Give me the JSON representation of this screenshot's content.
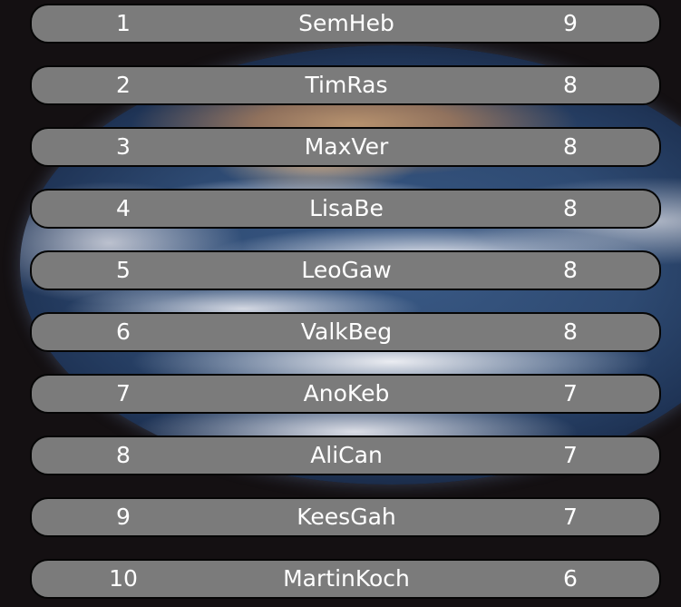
{
  "leaderboard": {
    "rows": [
      {
        "rank": "1",
        "name": "SemHeb",
        "score": "9"
      },
      {
        "rank": "2",
        "name": "TimRas",
        "score": "8"
      },
      {
        "rank": "3",
        "name": "MaxVer",
        "score": "8"
      },
      {
        "rank": "4",
        "name": "LisaBe",
        "score": "8"
      },
      {
        "rank": "5",
        "name": "LeoGaw",
        "score": "8"
      },
      {
        "rank": "6",
        "name": "ValkBeg",
        "score": "8"
      },
      {
        "rank": "7",
        "name": "AnoKeb",
        "score": "7"
      },
      {
        "rank": "8",
        "name": "AliCan",
        "score": "7"
      },
      {
        "rank": "9",
        "name": "KeesGah",
        "score": "7"
      },
      {
        "rank": "10",
        "name": "MartinKoch",
        "score": "6"
      }
    ]
  },
  "colors": {
    "background": "#141012",
    "row_fill": "#7b7b7b",
    "row_border": "#050505",
    "text": "#ffffff"
  },
  "background_image": "earth-from-space"
}
